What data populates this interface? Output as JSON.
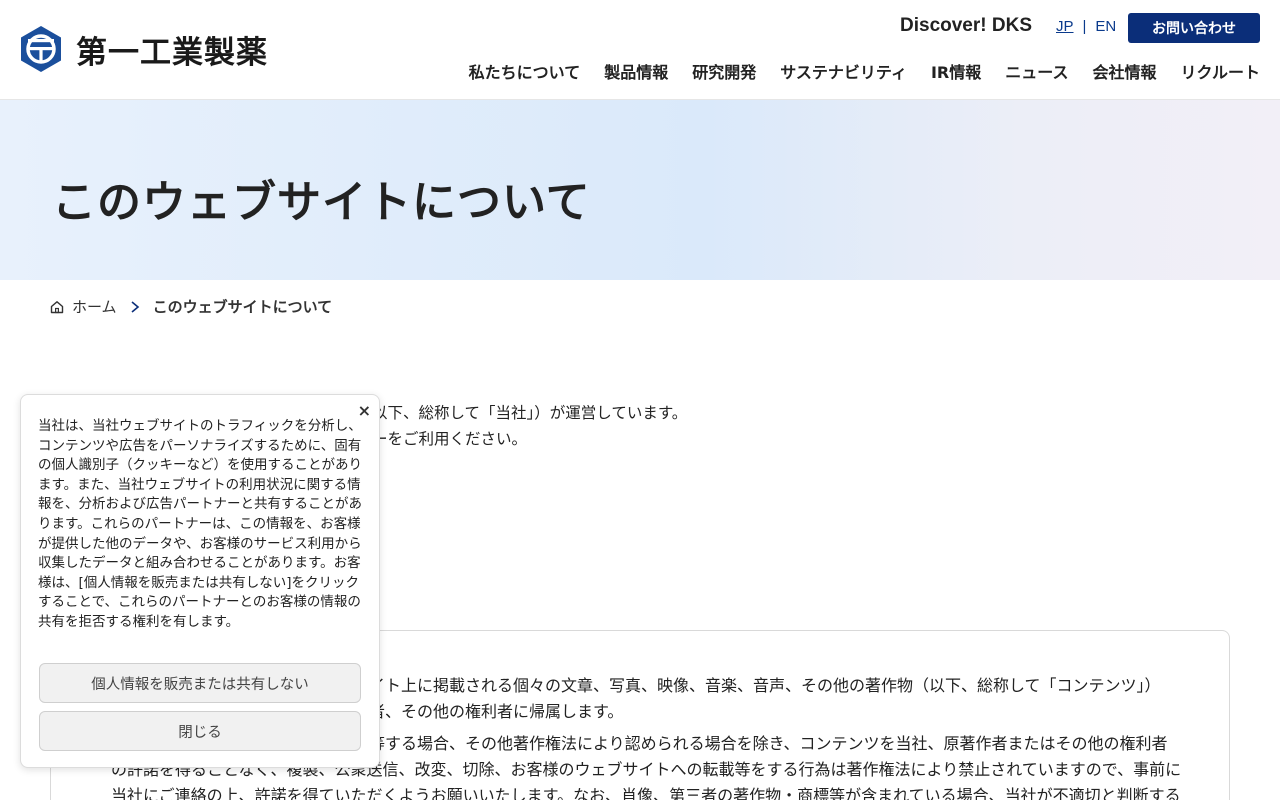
{
  "header": {
    "logo_text": "第一工業製薬",
    "discover": "Discover! DKS",
    "lang_jp": "JP",
    "lang_sep": "|",
    "lang_en": "EN",
    "contact_label": "お問い合わせ",
    "nav": [
      "私たちについて",
      "製品情報",
      "研究開発",
      "サステナビリティ",
      "IR情報",
      "ニュース",
      "会社情報",
      "リクルート"
    ],
    "brand_color": "#0b2e79"
  },
  "hero": {
    "title": "このウェブサイトについて"
  },
  "breadcrumb": {
    "home": "ホーム",
    "current": "このウェブサイトについて"
  },
  "intro": {
    "line1": "以下、総称して「当社」）が運営しています。",
    "line2": "ーをご利用ください。"
  },
  "card": {
    "p1_line1": "イト上に掲載される個々の文章、写真、映像、音楽、音声、その他の著作物（以下、総称して「コンテンツ」）",
    "p1_line2": "者、その他の権利者に帰属します。",
    "p2_line1": "等する場合、その他著作権法により認められる場合を除き、コンテンツを当社、原著作者またはその他の権利者",
    "p2_line2": "の許諾を得ることなく、複製、公衆送信、改変、切除、お客様のウェブサイトへの転載等をする行為は著作権法により禁止されていますので、事前に",
    "p2_line3": "当社にご連絡の上、許諾を得ていただくようお願いいたします。なお、肖像、第三者の著作物・商標等が含まれている場合、当社が不適切と判断する"
  },
  "cookie": {
    "close": "×",
    "text": "当社は、当社ウェブサイトのトラフィックを分析し、コンテンツや広告をパーソナライズするために、固有の個人識別子（クッキーなど）を使用することがあります。また、当社ウェブサイトの利用状況に関する情報を、分析および広告パートナーと共有することがあります。これらのパートナーは、この情報を、お客様が提供した他のデータや、お客様のサービス利用から収集したデータと組み合わせることがあります。お客様は、[個人情報を販売または共有しない]をクリックすることで、これらのパートナーとのお客様の情報の共有を拒否する権利を有します。",
    "btn_optout": "個人情報を販売または共有しない",
    "btn_close": "閉じる"
  }
}
